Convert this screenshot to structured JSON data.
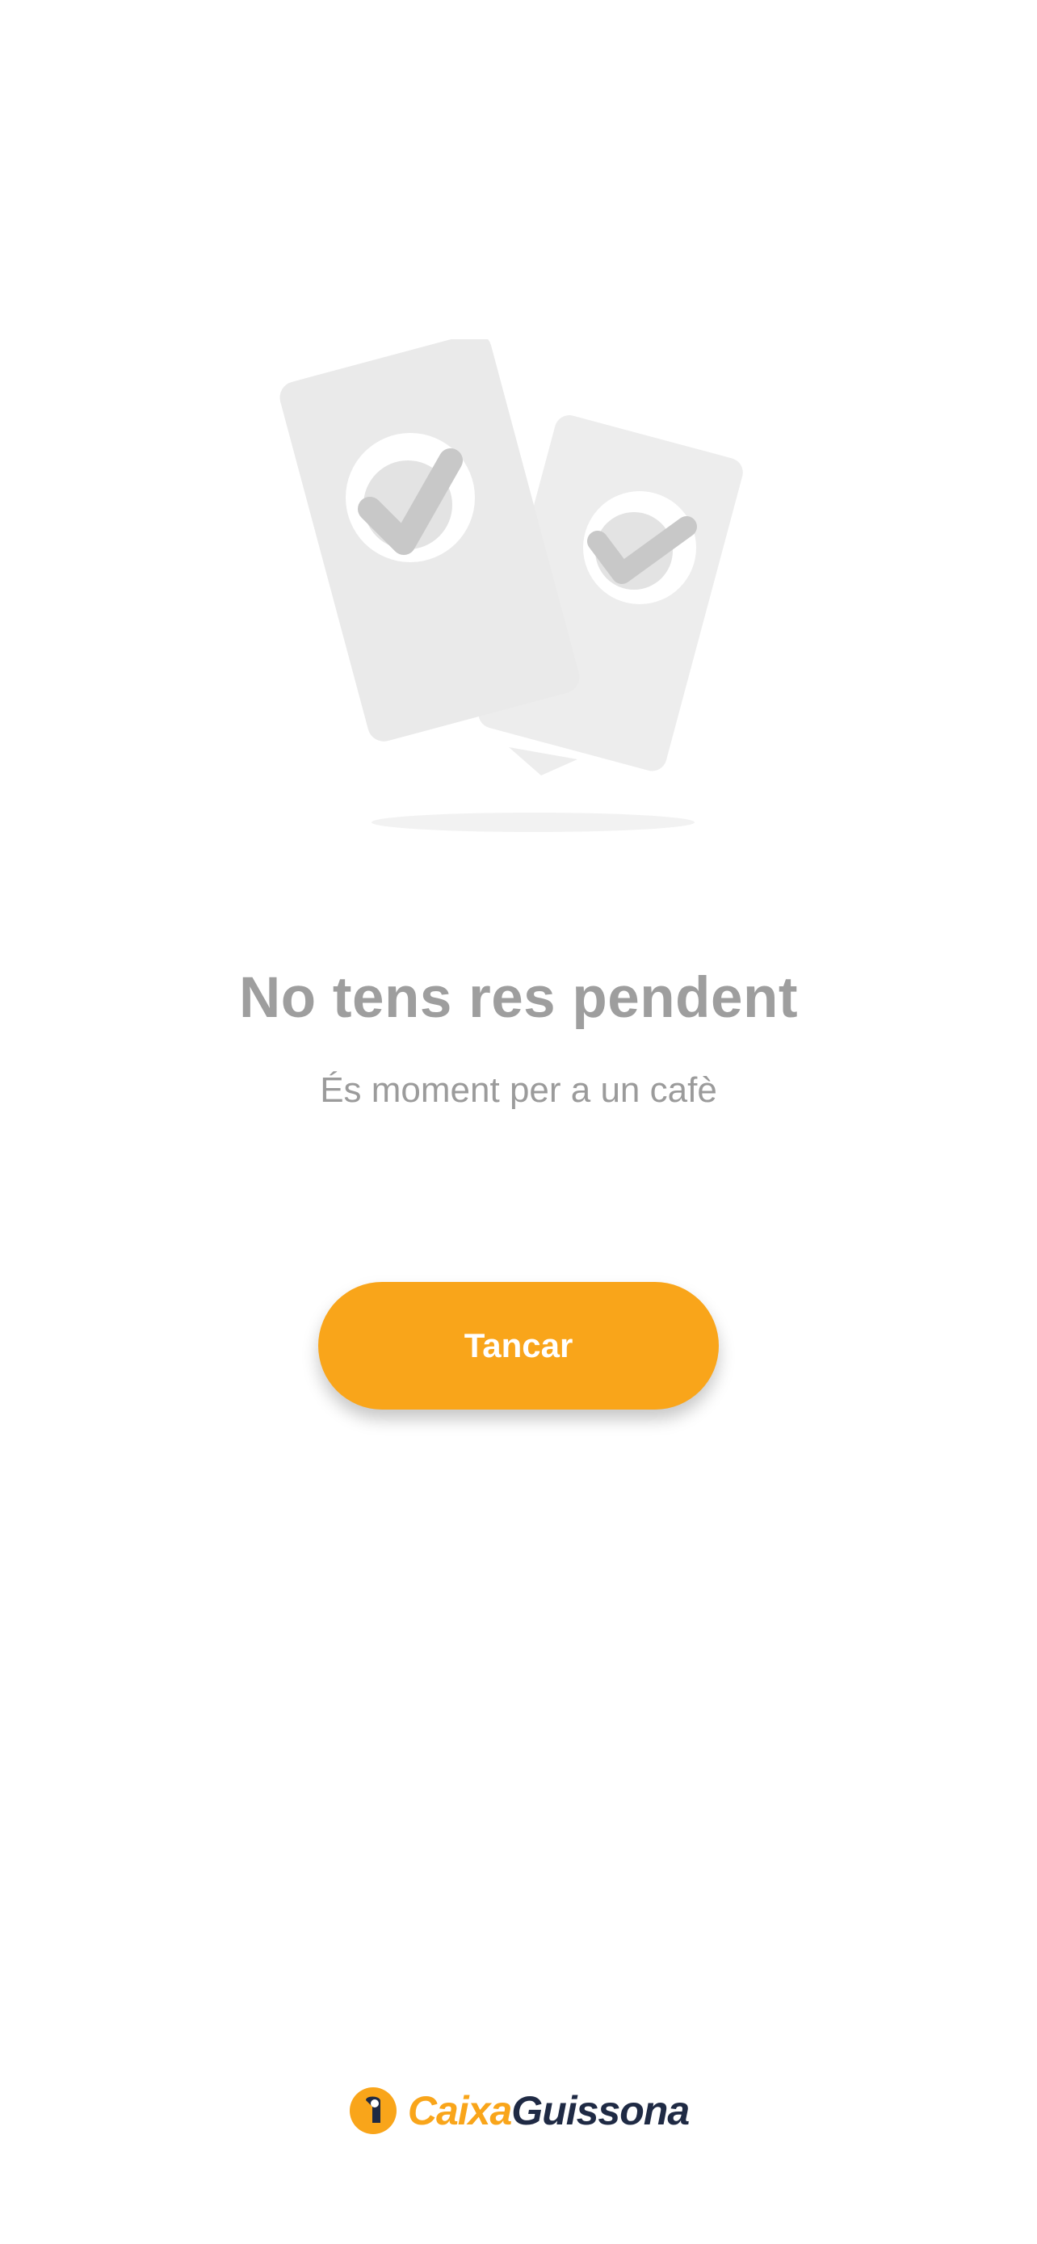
{
  "empty_state": {
    "title": "No tens res pendent",
    "subtitle": "És moment per a un cafè"
  },
  "actions": {
    "close_label": "Tancar"
  },
  "footer": {
    "brand_part1": "Caixa",
    "brand_part2": "Guissona"
  },
  "colors": {
    "accent": "#f9a51a",
    "brand_dark": "#1f2a44",
    "muted_text": "#9e9e9e",
    "illustration_fill": "#ececec",
    "check_fill": "#c8c8c8"
  },
  "icons": {
    "illustration": "cards-with-checkmarks-icon",
    "brand": "caixa-guissona-logo-icon"
  }
}
